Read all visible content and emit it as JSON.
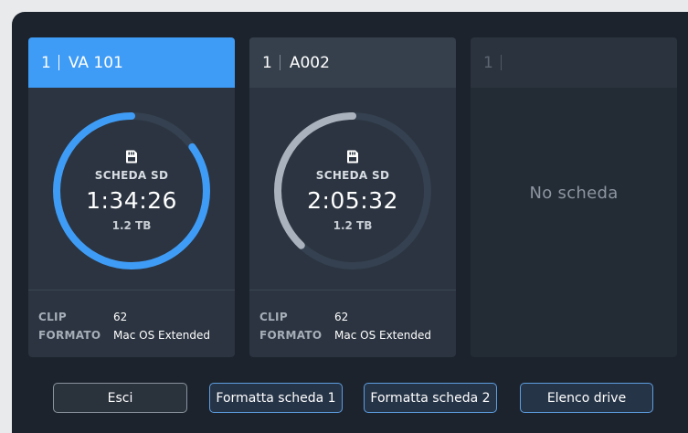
{
  "slots": [
    {
      "slot": "1",
      "name": "VA 101",
      "media": "SCHEDA SD",
      "timecode": "1:34:26",
      "capacity": "1.2 TB",
      "fill_percent": 85,
      "ring_color": "#3f9cf6",
      "clip_label": "CLIP",
      "clip_value": "62",
      "format_label": "FORMATO",
      "format_value": "Mac OS Extended"
    },
    {
      "slot": "1",
      "name": "A002",
      "media": "SCHEDA SD",
      "timecode": "2:05:32",
      "capacity": "1.2 TB",
      "fill_percent": 38,
      "ring_color": "#aab2bd",
      "clip_label": "CLIP",
      "clip_value": "62",
      "format_label": "FORMATO",
      "format_value": "Mac OS Extended"
    },
    {
      "slot": "1",
      "name": "",
      "empty_text": "No scheda"
    }
  ],
  "buttons": {
    "exit": "Esci",
    "format1": "Formatta scheda 1",
    "format2": "Formatta scheda 2",
    "drive_list": "Elenco drive"
  },
  "colors": {
    "accent": "#3f9cf6",
    "track": "#354150",
    "background": "#1c232c"
  }
}
